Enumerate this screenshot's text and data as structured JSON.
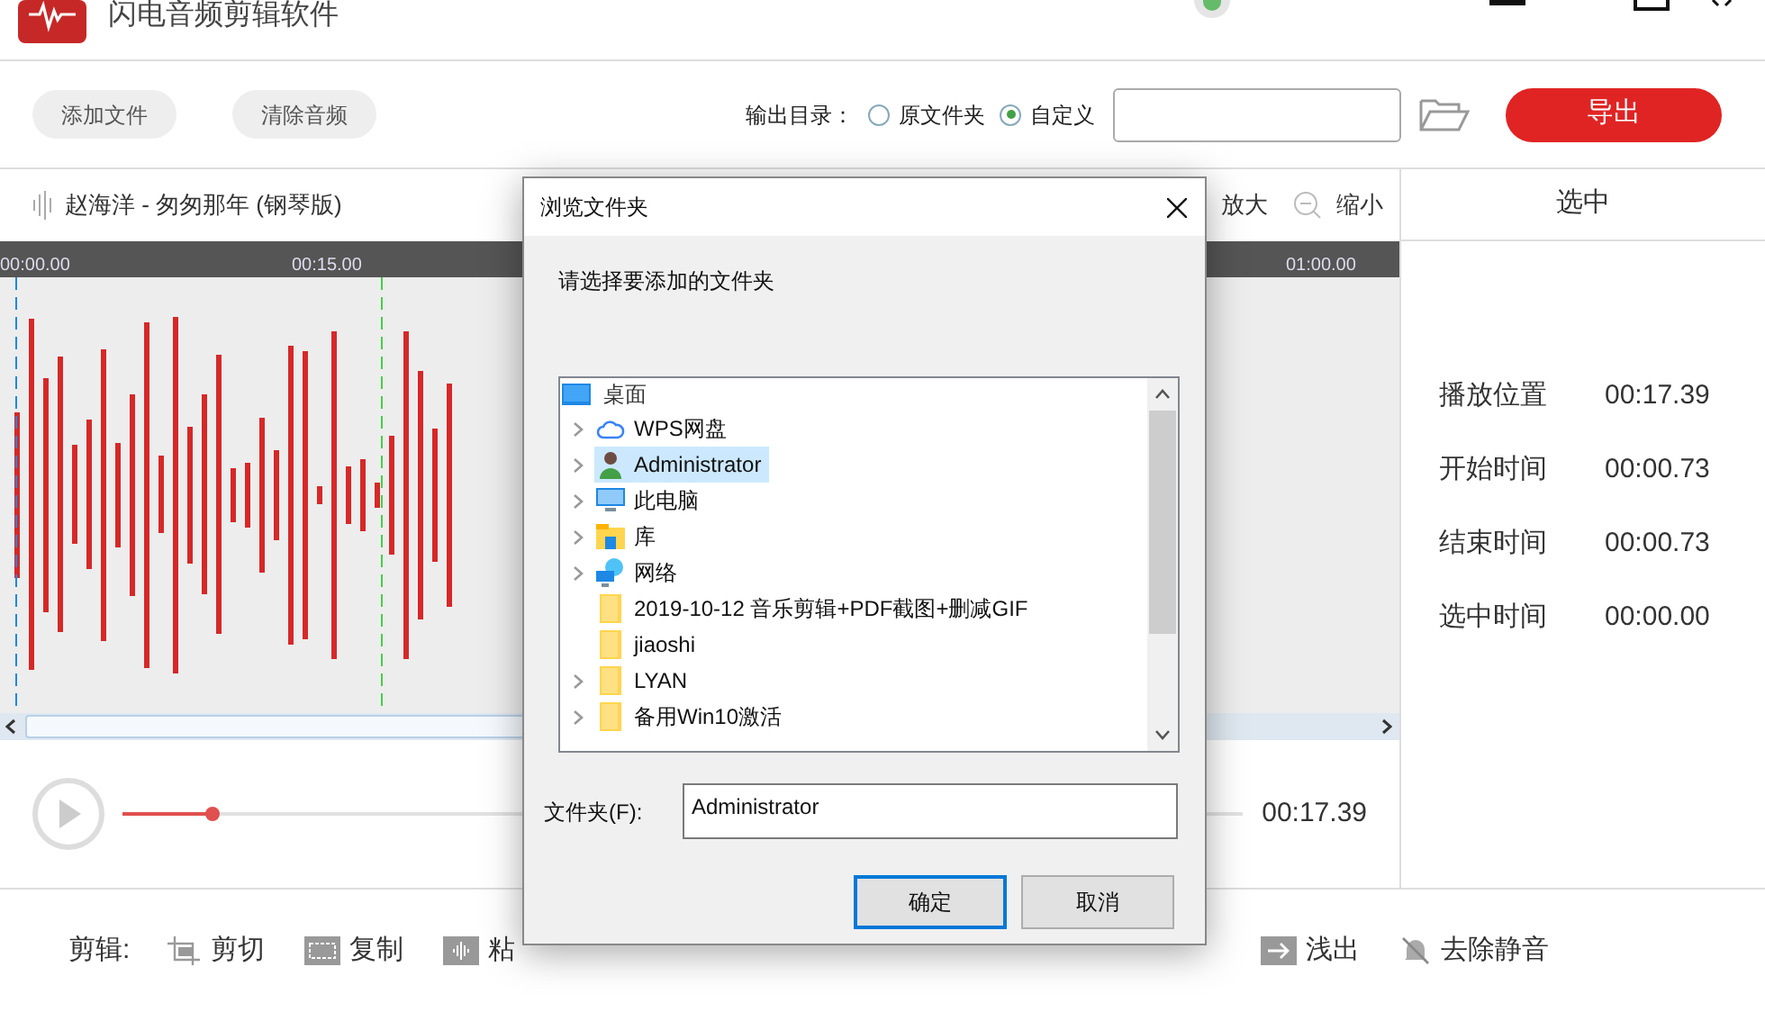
{
  "app": {
    "title": "闪电音频剪辑软件"
  },
  "toolbar": {
    "buttons": [
      "添加文件",
      "清除音频"
    ],
    "output_label": "输出目录：",
    "output_options": [
      {
        "label": "原文件夹",
        "selected": false
      },
      {
        "label": "自定义",
        "selected": true
      }
    ],
    "export_button": "导出"
  },
  "track": {
    "title": "赵海洋 - 匆匆那年 (钢琴版)",
    "zoom_buttons": [
      {
        "label": "放大",
        "kind": "zoom-in"
      },
      {
        "label": "缩小",
        "kind": "zoom-out"
      }
    ],
    "ruler_labels": [
      "00:00.00",
      "00:15.00",
      "01:00.00"
    ]
  },
  "player": {
    "level": 0.08,
    "time": "00:17.39"
  },
  "edit_bar": {
    "label": "剪辑:",
    "tools": [
      {
        "label": "剪切",
        "kind": "cut"
      },
      {
        "label": "复制",
        "kind": "copy"
      },
      {
        "label": "粘",
        "kind": "paste"
      },
      {
        "label": "浅出",
        "kind": "fade-out"
      },
      {
        "label": "去除静音",
        "kind": "mute"
      }
    ]
  },
  "selection_panel": {
    "title": "选中",
    "rows": [
      {
        "label": "播放位置",
        "value": "00:17.39"
      },
      {
        "label": "开始时间",
        "value": "00:00.73"
      },
      {
        "label": "结束时间",
        "value": "00:00.73"
      },
      {
        "label": "选中时间",
        "value": "00:00.00"
      }
    ]
  },
  "dialog": {
    "title": "浏览文件夹",
    "prompt": "请选择要添加的文件夹",
    "tree": {
      "label": "桌面",
      "kind": "desktop",
      "selected": false,
      "children": [
        {
          "label": "WPS网盘",
          "kind": "cloud",
          "expandable": true,
          "selected": false
        },
        {
          "label": "Administrator",
          "kind": "user",
          "expandable": true,
          "selected": true
        },
        {
          "label": "此电脑",
          "kind": "pc",
          "expandable": true,
          "selected": false
        },
        {
          "label": "库",
          "kind": "library",
          "expandable": true,
          "selected": false
        },
        {
          "label": "网络",
          "kind": "network",
          "expandable": true,
          "selected": false
        },
        {
          "label": "2019-10-12 音乐剪辑+PDF截图+删减GIF",
          "kind": "folder",
          "expandable": false,
          "selected": false
        },
        {
          "label": "jiaoshi",
          "kind": "folder",
          "expandable": false,
          "selected": false
        },
        {
          "label": "LYAN",
          "kind": "folder",
          "expandable": true,
          "selected": false
        },
        {
          "label": "备用Win10激活",
          "kind": "folder",
          "expandable": true,
          "selected": false
        }
      ]
    },
    "folder_label": "文件夹(F):",
    "folder_value": "Administrator",
    "buttons": [
      {
        "label": "确定",
        "default": true
      },
      {
        "label": "取消",
        "default": false
      }
    ]
  }
}
